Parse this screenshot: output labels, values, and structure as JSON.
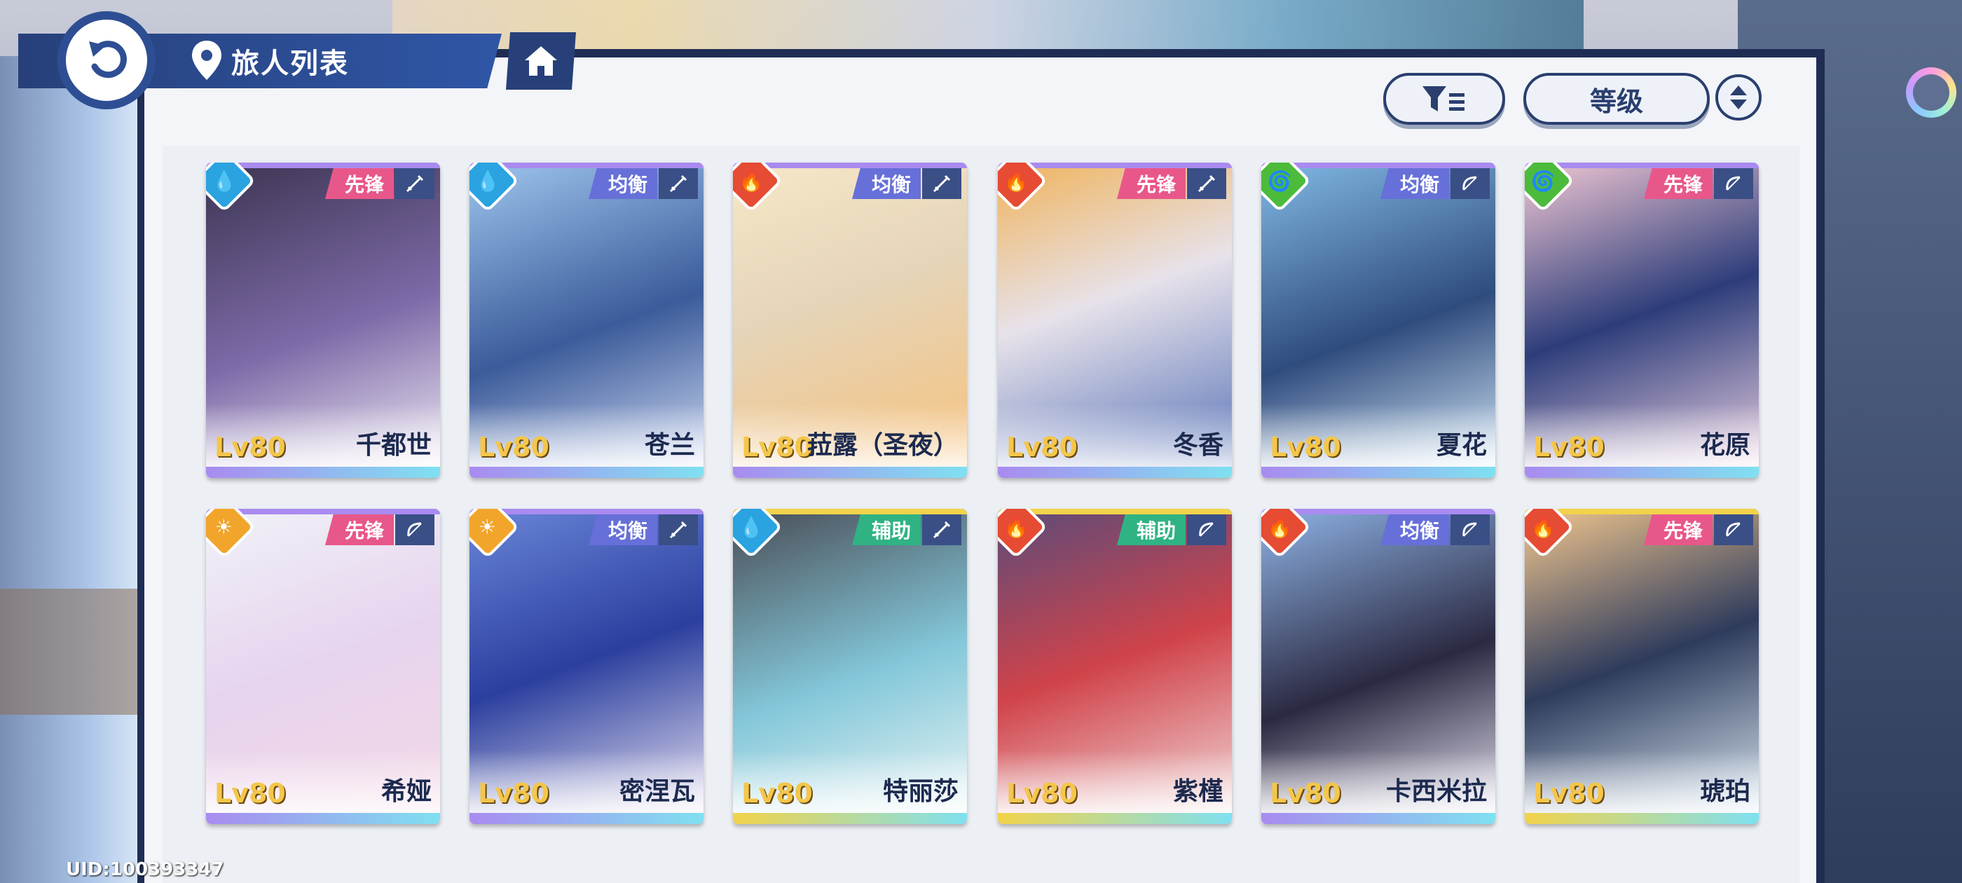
{
  "header": {
    "title": "旅人列表"
  },
  "controls": {
    "sort_label": "等级"
  },
  "uid": "UID:100393347",
  "colors": {
    "water": "#2aa3e0",
    "fire": "#e64b33",
    "wind": "#4cbb3c",
    "light": "#f2a52b",
    "role_vanguard": "#e8578a",
    "role_balance": "#6670d8",
    "role_support": "#2fb383",
    "strip_purple": "#a98bf0",
    "strip_gold": "#f2d34a"
  },
  "characters": [
    {
      "level": "Lv80",
      "name": "千都世",
      "role": "先锋",
      "element": "water-icon",
      "weapon": "sword-icon"
    },
    {
      "level": "Lv80",
      "name": "苍兰",
      "role": "均衡",
      "element": "water-icon",
      "weapon": "sword-icon"
    },
    {
      "level": "Lv80",
      "name": "菈露（圣夜）",
      "role": "均衡",
      "element": "fire-icon",
      "weapon": "sword-icon"
    },
    {
      "level": "Lv80",
      "name": "冬香",
      "role": "先锋",
      "element": "fire-icon",
      "weapon": "sword-icon"
    },
    {
      "level": "Lv80",
      "name": "夏花",
      "role": "均衡",
      "element": "wind-icon",
      "weapon": "bow-icon"
    },
    {
      "level": "Lv80",
      "name": "花原",
      "role": "先锋",
      "element": "wind-icon",
      "weapon": "bow-icon"
    },
    {
      "level": "Lv80",
      "name": "希娅",
      "role": "先锋",
      "element": "light-icon",
      "weapon": "bow-icon"
    },
    {
      "level": "Lv80",
      "name": "密涅瓦",
      "role": "均衡",
      "element": "light-icon",
      "weapon": "sword-icon"
    },
    {
      "level": "Lv80",
      "name": "特丽莎",
      "role": "辅助",
      "element": "water-icon",
      "weapon": "sword-icon"
    },
    {
      "level": "Lv80",
      "name": "紫槿",
      "role": "辅助",
      "element": "fire-icon",
      "weapon": "bow-icon"
    },
    {
      "level": "Lv80",
      "name": "卡西米拉",
      "role": "均衡",
      "element": "fire-icon",
      "weapon": "bow-icon"
    },
    {
      "level": "Lv80",
      "name": "琥珀",
      "role": "先锋",
      "element": "fire-icon",
      "weapon": "bow-icon"
    }
  ]
}
